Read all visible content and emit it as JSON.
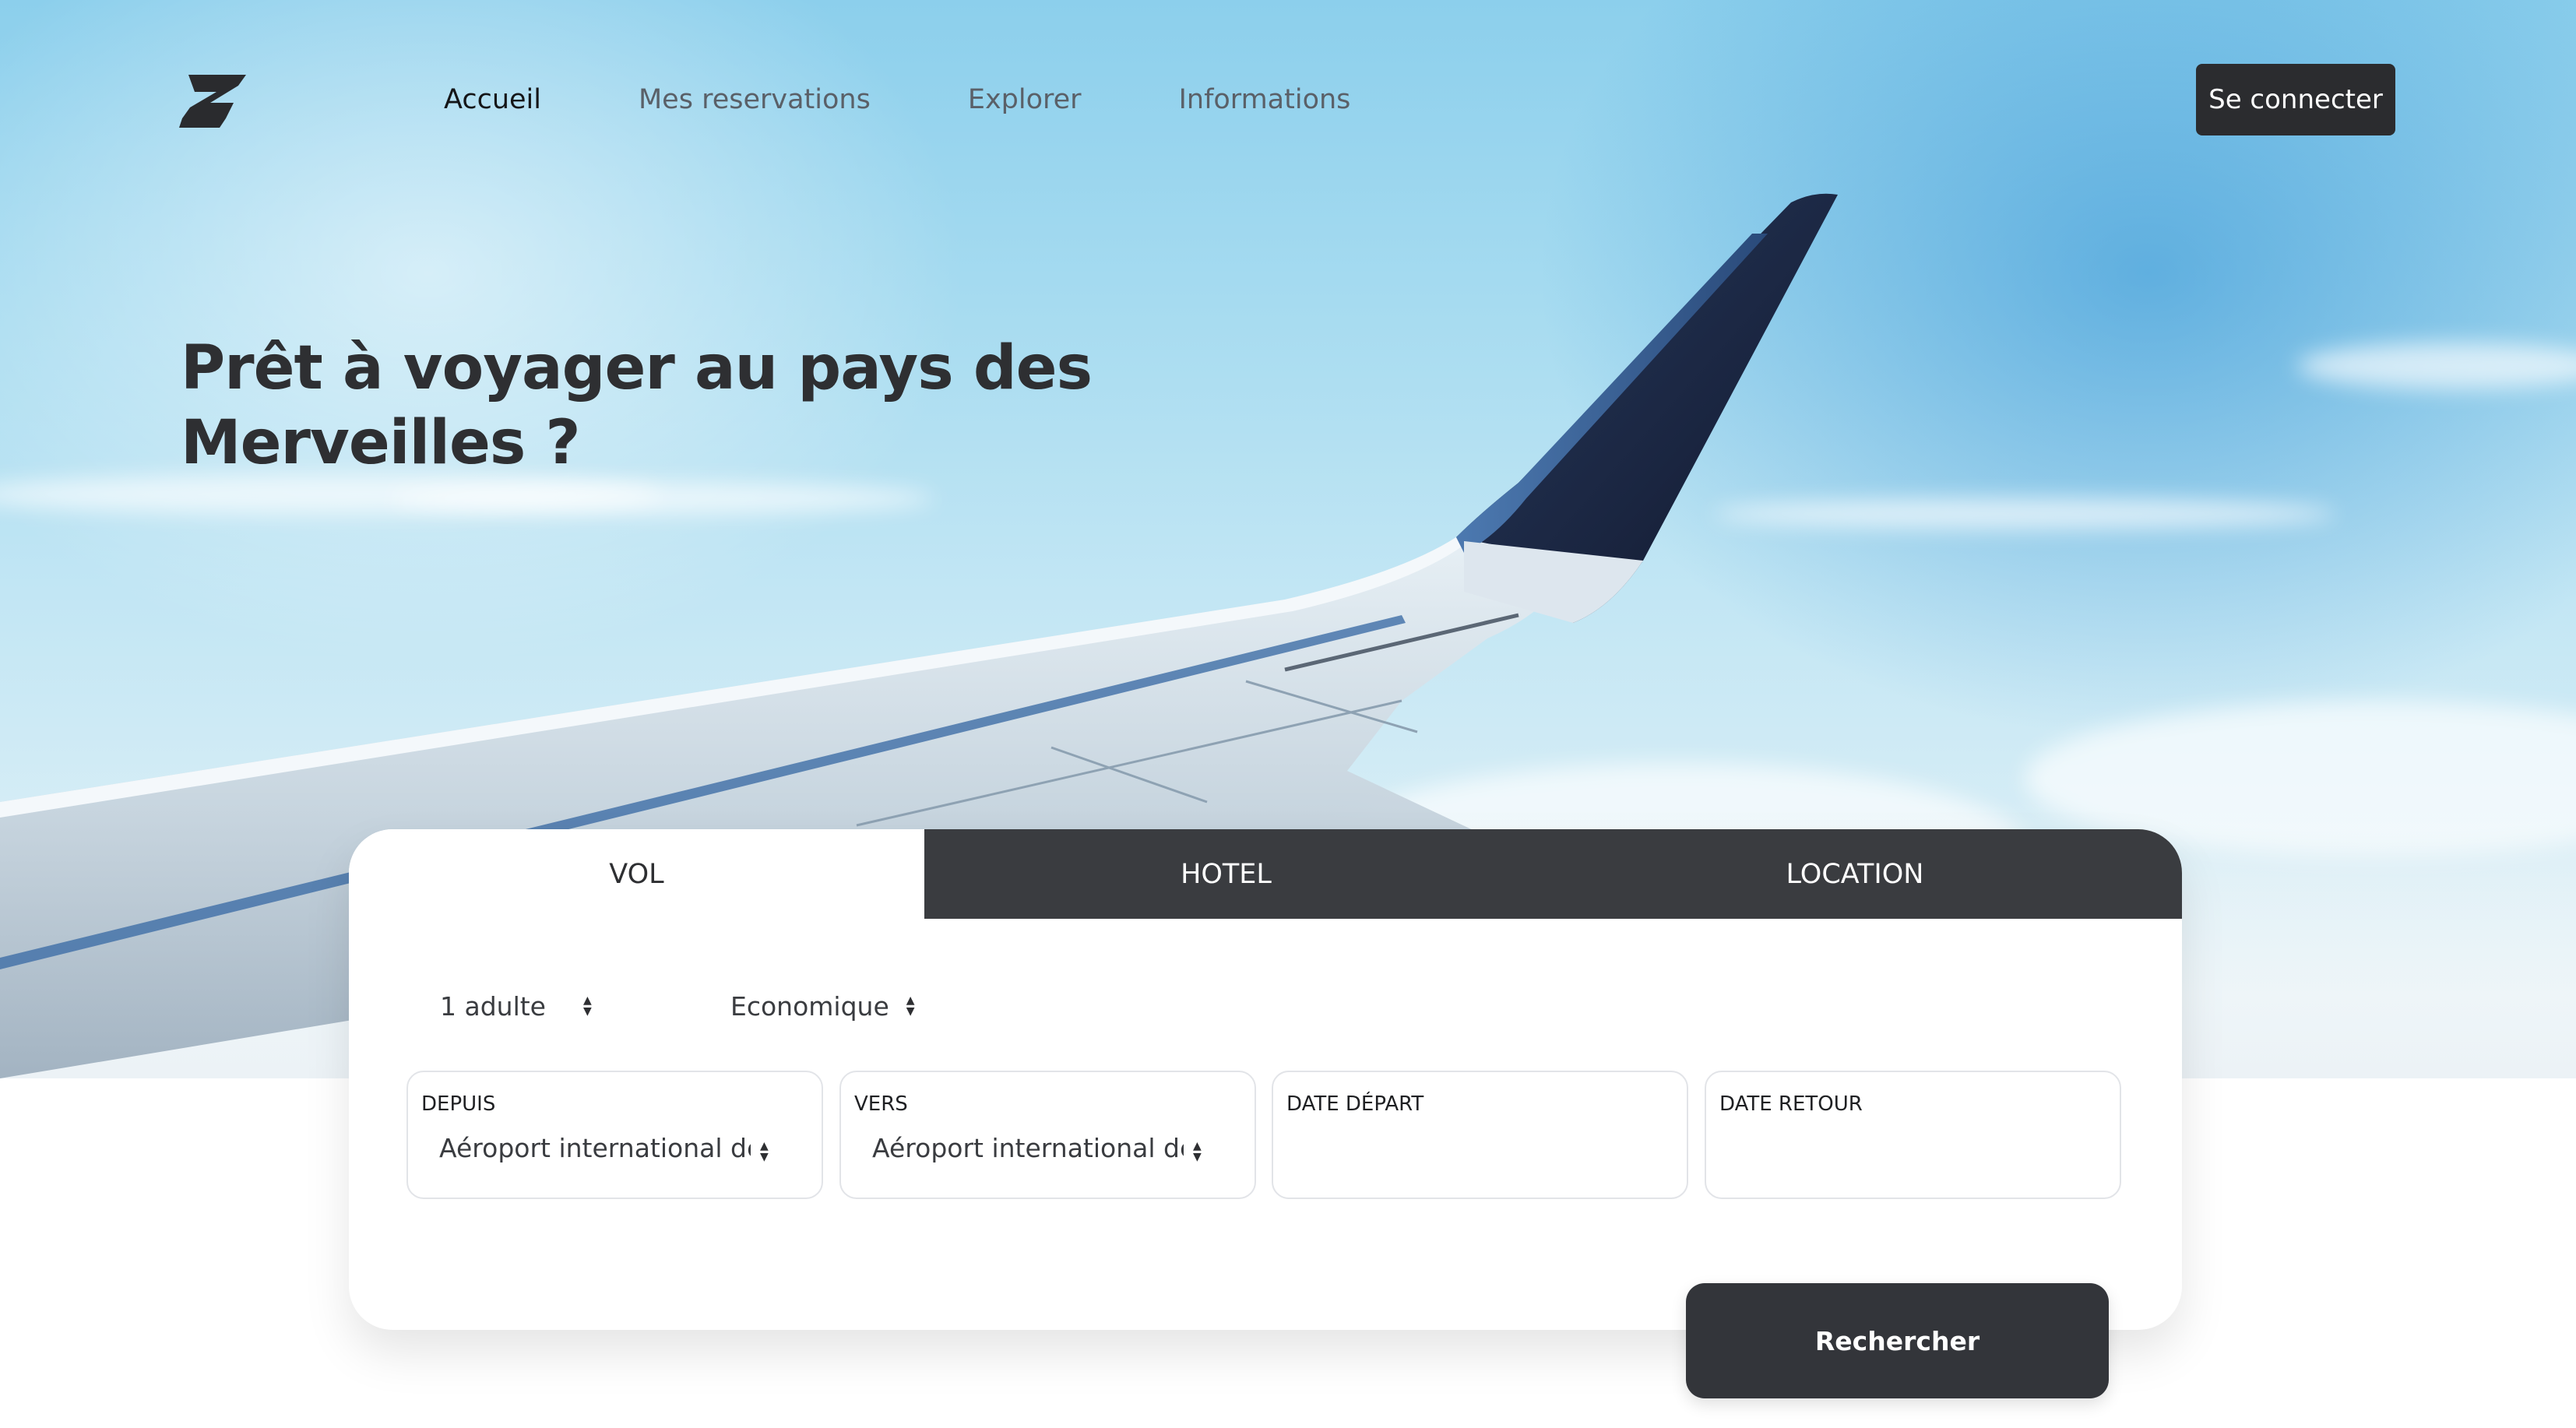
{
  "brand": {
    "logo_icon": "z-logo-icon"
  },
  "nav": {
    "items": [
      {
        "label": "Accueil",
        "active": true
      },
      {
        "label": "Mes reservations",
        "active": false
      },
      {
        "label": "Explorer",
        "active": false
      },
      {
        "label": "Informations",
        "active": false
      }
    ],
    "login_label": "Se connecter"
  },
  "hero": {
    "headline_line1": "Prêt à voyager au pays des",
    "headline_line2": "Merveilles ?"
  },
  "booking": {
    "tabs": [
      {
        "label": "VOL",
        "active": true
      },
      {
        "label": "HOTEL",
        "active": false
      },
      {
        "label": "LOCATION",
        "active": false
      }
    ],
    "passengers": "1 adulte",
    "cabin_class": "Economique",
    "fields": [
      {
        "label": "DEPUIS",
        "value": "Aéroport international de"
      },
      {
        "label": "VERS",
        "value": "Aéroport international de"
      },
      {
        "label": "DATE DÉPART",
        "value": ""
      },
      {
        "label": "DATE RETOUR",
        "value": ""
      }
    ],
    "search_label": "Rechercher"
  },
  "colors": {
    "dark": "#2b2c2f",
    "tab_dark": "#3a3c40",
    "sky": "#8ccfec"
  }
}
